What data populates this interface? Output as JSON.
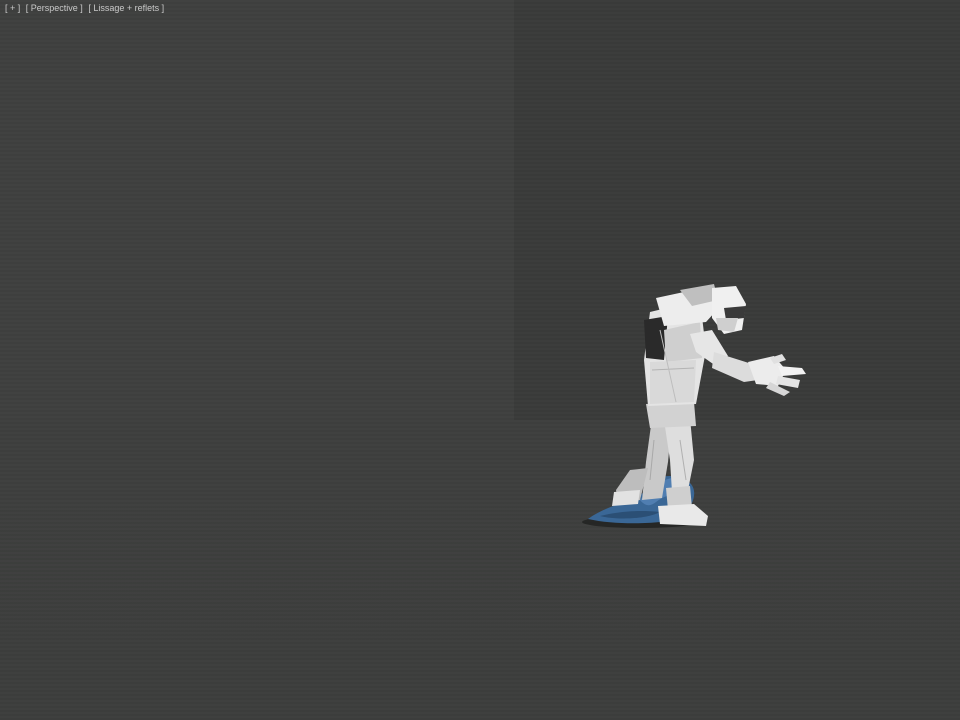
{
  "viewport": {
    "label_parts": [
      "[ + ]",
      "[ Perspective ]",
      "[ Lissage + reflets ]"
    ]
  },
  "colors": {
    "background": "#3f403f",
    "back_wall": "#3a3b3a",
    "character_mesh": "#d8d8d8",
    "cloth_object": "#3f6b9a"
  }
}
